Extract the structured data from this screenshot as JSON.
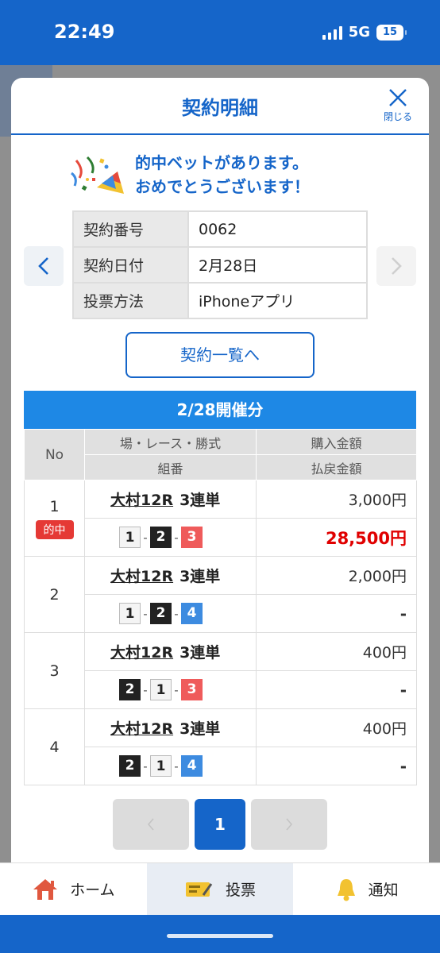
{
  "status_bar": {
    "time": "22:49",
    "network": "5G",
    "battery": "15"
  },
  "modal": {
    "title": "契約明細",
    "close_label": "閉じる",
    "congrats_line1": "的中ベットがあります。",
    "congrats_line2": "おめでとうございます！",
    "info": [
      {
        "key": "契約番号",
        "value": "0062"
      },
      {
        "key": "契約日付",
        "value": "2月28日"
      },
      {
        "key": "投票方法",
        "value": "iPhoneアプリ"
      }
    ],
    "list_button": "契約一覧へ",
    "date_header": "2/28開催分",
    "table_headers": {
      "no": "No",
      "race": "場・レース・勝式",
      "combo": "組番",
      "purchase": "購入金額",
      "payout": "払戻金額"
    },
    "hit_label": "的中",
    "bets": [
      {
        "no": "1",
        "venue": "大村12R",
        "type": "3連単",
        "purchase": "3,000円",
        "payout": "28,500円"
      },
      {
        "no": "2",
        "venue": "大村12R",
        "type": "3連単",
        "purchase": "2,000円",
        "payout": "-"
      },
      {
        "no": "3",
        "venue": "大村12R",
        "type": "3連単",
        "purchase": "400円",
        "payout": "-"
      },
      {
        "no": "4",
        "venue": "大村12R",
        "type": "3連単",
        "purchase": "400円",
        "payout": "-"
      }
    ],
    "combos": [
      [
        "1",
        "2",
        "3"
      ],
      [
        "1",
        "2",
        "4"
      ],
      [
        "2",
        "1",
        "3"
      ],
      [
        "2",
        "1",
        "4"
      ]
    ],
    "page": "1"
  },
  "tabs": {
    "home": "ホーム",
    "vote": "投票",
    "notify": "通知"
  }
}
